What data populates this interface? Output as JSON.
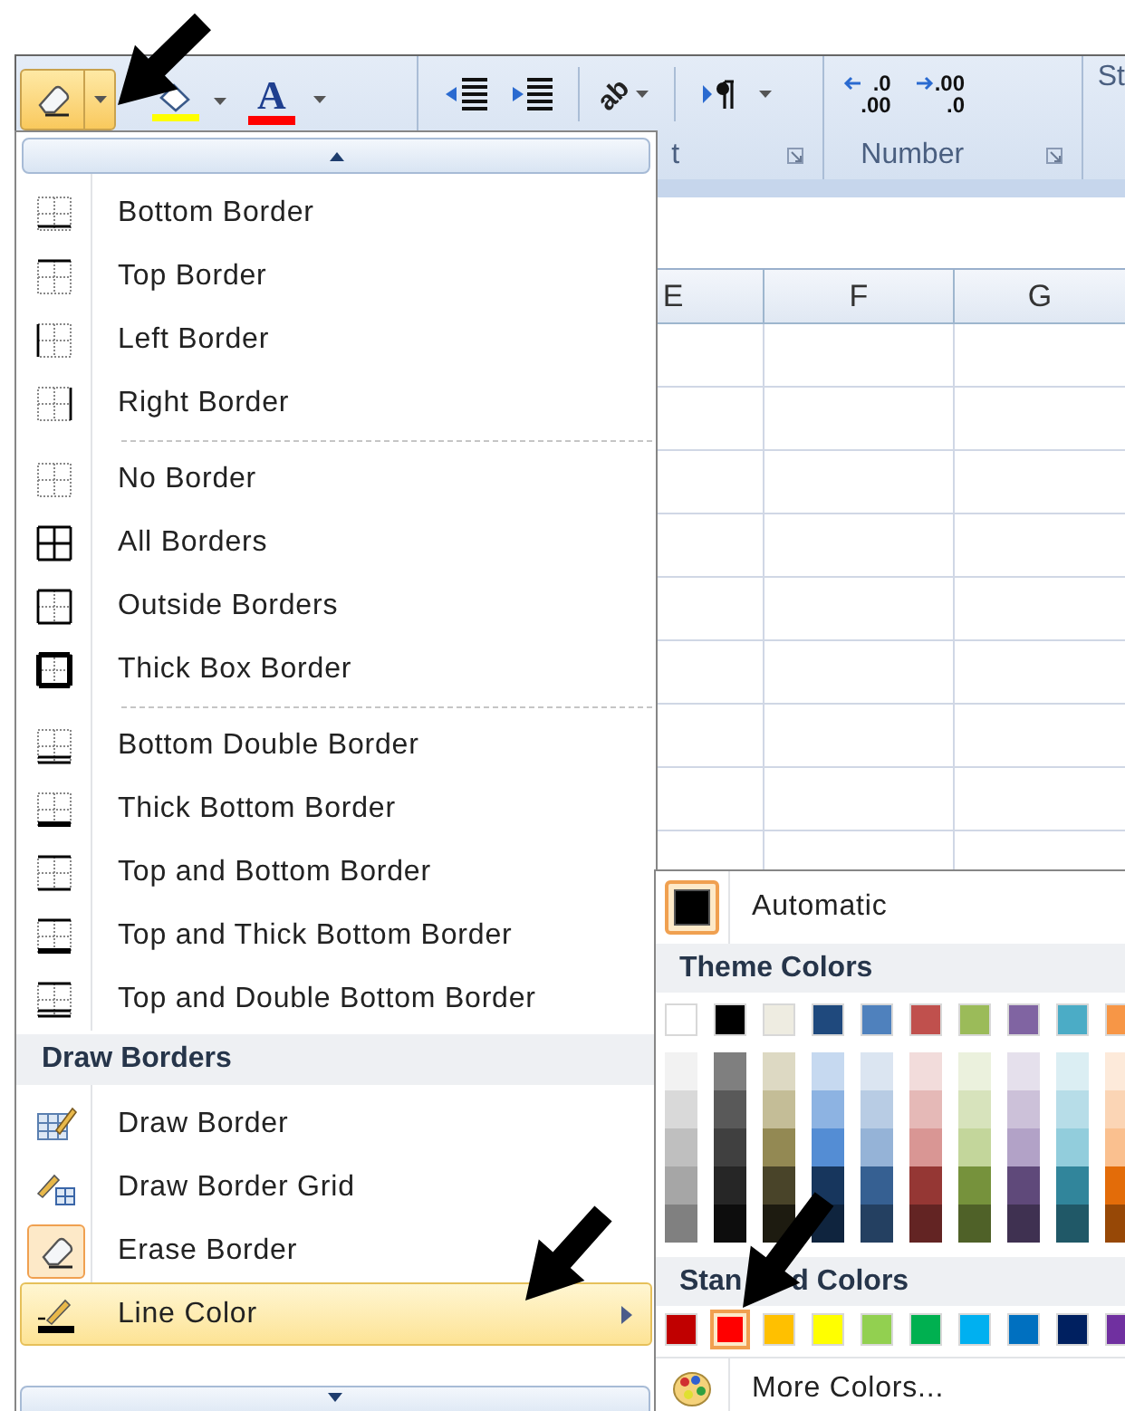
{
  "ribbon": {
    "eraser_button": {
      "pressed": true
    },
    "fill_color": {
      "color": "#ffff00"
    },
    "font_color": {
      "letter": "A",
      "color": "#ff0000"
    },
    "orientation_glyph": "ab",
    "decimal_buttons": [
      {
        "top": ".0",
        "bottom": ".00"
      },
      {
        "top": ".00",
        "bottom": ".0"
      }
    ],
    "group_labels": [
      "t",
      "Number"
    ],
    "cut_tab_text": "St"
  },
  "sheet": {
    "columns": [
      "E",
      "F",
      "G"
    ]
  },
  "borders_menu": {
    "sections": [
      {
        "items": [
          {
            "label": "Bottom Border",
            "kind": "bottom"
          },
          {
            "label": "Top Border",
            "kind": "top"
          },
          {
            "label": "Left Border",
            "kind": "left"
          },
          {
            "label": "Right Border",
            "kind": "right"
          }
        ]
      },
      {
        "items": [
          {
            "label": "No Border",
            "kind": "none"
          },
          {
            "label": "All Borders",
            "kind": "all"
          },
          {
            "label": "Outside Borders",
            "kind": "outside"
          },
          {
            "label": "Thick Box Border",
            "kind": "thick_box"
          }
        ]
      },
      {
        "items": [
          {
            "label": "Bottom Double Border",
            "kind": "bottom_double"
          },
          {
            "label": "Thick Bottom Border",
            "kind": "thick_bottom"
          },
          {
            "label": "Top and Bottom Border",
            "kind": "top_bottom"
          },
          {
            "label": "Top and Thick Bottom Border",
            "kind": "top_thick_bottom"
          },
          {
            "label": "Top and Double Bottom Border",
            "kind": "top_double_bottom"
          }
        ]
      }
    ],
    "draw_header": "Draw Borders",
    "draw_items": [
      {
        "label": "Draw Border",
        "kind": "draw_border",
        "checked": false,
        "selected": false,
        "submenu": false
      },
      {
        "label": "Draw Border Grid",
        "kind": "draw_grid",
        "checked": false,
        "selected": false,
        "submenu": false
      },
      {
        "label": "Erase Border",
        "kind": "erase",
        "checked": true,
        "selected": false,
        "submenu": false
      },
      {
        "label": "Line Color",
        "kind": "line_color",
        "checked": false,
        "selected": true,
        "submenu": true
      }
    ]
  },
  "color_submenu": {
    "automatic": {
      "label": "Automatic",
      "selected": true
    },
    "theme_header": "Theme Colors",
    "theme_colors": [
      {
        "color": "#ffffff",
        "selected": false,
        "shades": [
          {
            "color": "#f2f2f2"
          },
          {
            "color": "#d9d9d9"
          },
          {
            "color": "#bfbfbf"
          },
          {
            "color": "#a6a6a6"
          },
          {
            "color": "#808080"
          }
        ]
      },
      {
        "color": "#000000",
        "selected": false,
        "shades": [
          {
            "color": "#7f7f7f"
          },
          {
            "color": "#595959"
          },
          {
            "color": "#404040"
          },
          {
            "color": "#262626"
          },
          {
            "color": "#0d0d0d"
          }
        ]
      },
      {
        "color": "#eeece1",
        "selected": false,
        "shades": [
          {
            "color": "#ddd9c3"
          },
          {
            "color": "#c4bd97"
          },
          {
            "color": "#938953"
          },
          {
            "color": "#494429"
          },
          {
            "color": "#1d1b10"
          }
        ]
      },
      {
        "color": "#1f497d",
        "selected": false,
        "shades": [
          {
            "color": "#c6d9f0"
          },
          {
            "color": "#8db3e2"
          },
          {
            "color": "#548dd4"
          },
          {
            "color": "#17365d"
          },
          {
            "color": "#0f243e"
          }
        ]
      },
      {
        "color": "#4f81bd",
        "selected": false,
        "shades": [
          {
            "color": "#dbe5f1"
          },
          {
            "color": "#b8cce4"
          },
          {
            "color": "#95b3d7"
          },
          {
            "color": "#366092"
          },
          {
            "color": "#244061"
          }
        ]
      },
      {
        "color": "#c0504d",
        "selected": false,
        "shades": [
          {
            "color": "#f2dcdb"
          },
          {
            "color": "#e5b9b7"
          },
          {
            "color": "#d99694"
          },
          {
            "color": "#953734"
          },
          {
            "color": "#632423"
          }
        ]
      },
      {
        "color": "#9bbb59",
        "selected": false,
        "shades": [
          {
            "color": "#ebf1dd"
          },
          {
            "color": "#d7e3bc"
          },
          {
            "color": "#c3d69b"
          },
          {
            "color": "#76923c"
          },
          {
            "color": "#4f6128"
          }
        ]
      },
      {
        "color": "#8064a2",
        "selected": false,
        "shades": [
          {
            "color": "#e5e0ec"
          },
          {
            "color": "#ccc1d9"
          },
          {
            "color": "#b2a2c7"
          },
          {
            "color": "#5f497a"
          },
          {
            "color": "#3f3151"
          }
        ]
      },
      {
        "color": "#4bacc6",
        "selected": false,
        "shades": [
          {
            "color": "#dbeef3"
          },
          {
            "color": "#b7dde8"
          },
          {
            "color": "#92cddc"
          },
          {
            "color": "#31859b"
          },
          {
            "color": "#205867"
          }
        ]
      },
      {
        "color": "#f79646",
        "selected": false,
        "shades": [
          {
            "color": "#fdeada"
          },
          {
            "color": "#fbd5b5"
          },
          {
            "color": "#fac08f"
          },
          {
            "color": "#e36c09"
          },
          {
            "color": "#974806"
          }
        ]
      }
    ],
    "standard_header_parts": [
      "Stan",
      "d Colors"
    ],
    "standard_colors": [
      {
        "color": "#c00000",
        "selected": false
      },
      {
        "color": "#ff0000",
        "selected": true
      },
      {
        "color": "#ffc000",
        "selected": false
      },
      {
        "color": "#ffff00",
        "selected": false
      },
      {
        "color": "#92d050",
        "selected": false
      },
      {
        "color": "#00b050",
        "selected": false
      },
      {
        "color": "#00b0f0",
        "selected": false
      },
      {
        "color": "#0070c0",
        "selected": false
      },
      {
        "color": "#002060",
        "selected": false
      },
      {
        "color": "#7030a0",
        "selected": false
      }
    ],
    "more_colors": "More Colors..."
  }
}
